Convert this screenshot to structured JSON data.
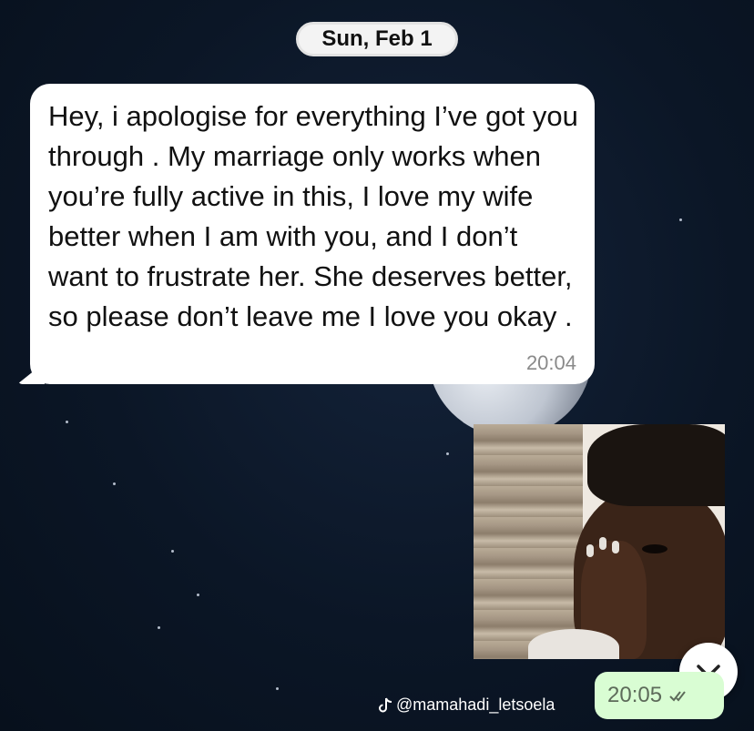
{
  "date_separator": "Sun, Feb 1",
  "incoming_message": {
    "text": "Hey, i apologise for everything I’ve got you through . My marriage only works when you’re fully active in this, I love my wife better when I am with you, and I don’t want to frustrate her. She deserves better, so please don’t leave me I love you okay .",
    "time": "20:04"
  },
  "outgoing_message": {
    "time": "20:05",
    "status_icon": "double-check-icon"
  },
  "scroll_button_icon": "chevron-down-icon",
  "watermark": {
    "icon": "tiktok-icon",
    "handle": "@mamahadi_letsoela"
  },
  "colors": {
    "incoming_bubble": "#ffffff",
    "outgoing_bubble": "#d9fdd3",
    "wallpaper": "#0b1626"
  }
}
